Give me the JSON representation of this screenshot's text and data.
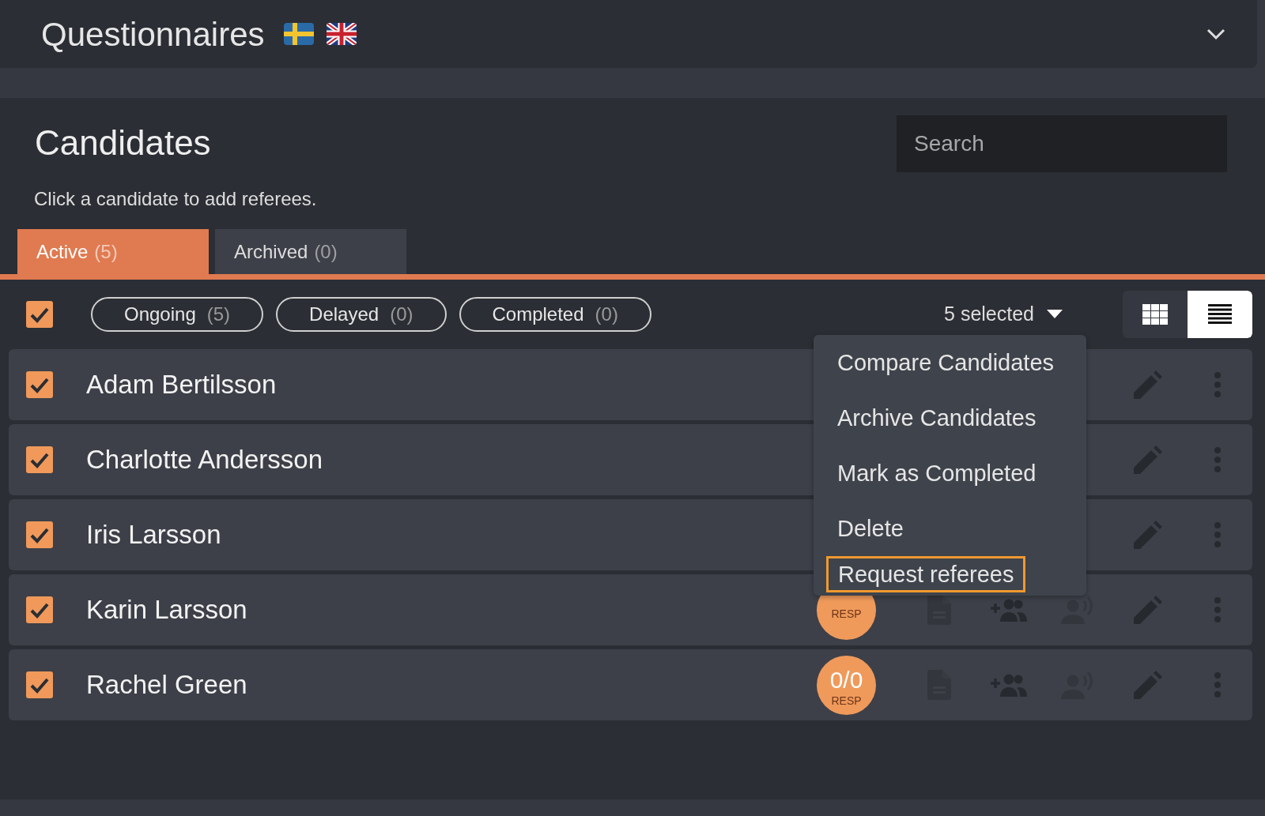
{
  "header": {
    "title": "Questionnaires"
  },
  "section": {
    "title": "Candidates",
    "subtitle": "Click a candidate to add referees.",
    "search": {
      "placeholder": "Search"
    }
  },
  "tabs": [
    {
      "label": "Active",
      "count": "(5)",
      "selected": true
    },
    {
      "label": "Archived",
      "count": "(0)",
      "selected": false
    }
  ],
  "select_all": {
    "checked": true
  },
  "filters": [
    {
      "label": "Ongoing",
      "count": "(5)"
    },
    {
      "label": "Delayed",
      "count": "(0)"
    },
    {
      "label": "Completed",
      "count": "(0)"
    }
  ],
  "selection_menu": {
    "label": "5 selected",
    "expanded": true,
    "items": [
      {
        "label": "Compare Candidates",
        "selected": false
      },
      {
        "label": "Archive Candidates",
        "selected": false
      },
      {
        "label": "Mark as Completed",
        "selected": false
      },
      {
        "label": "Delete",
        "selected": false
      },
      {
        "label": "Request referees",
        "selected": true
      }
    ]
  },
  "view_toggle": [
    {
      "kind": "grid",
      "selected": false
    },
    {
      "kind": "list",
      "selected": true
    }
  ],
  "candidates": [
    {
      "name": "Adam Bertilsson",
      "checked": true
    },
    {
      "name": "Charlotte Andersson",
      "checked": true
    },
    {
      "name": "Iris Larsson",
      "checked": true
    },
    {
      "name": "Karin Larsson",
      "checked": true,
      "badge": {
        "label": "RESP"
      }
    },
    {
      "name": "Rachel Green",
      "checked": true,
      "badge": {
        "value": "0/0",
        "label": "RESP"
      }
    }
  ]
}
